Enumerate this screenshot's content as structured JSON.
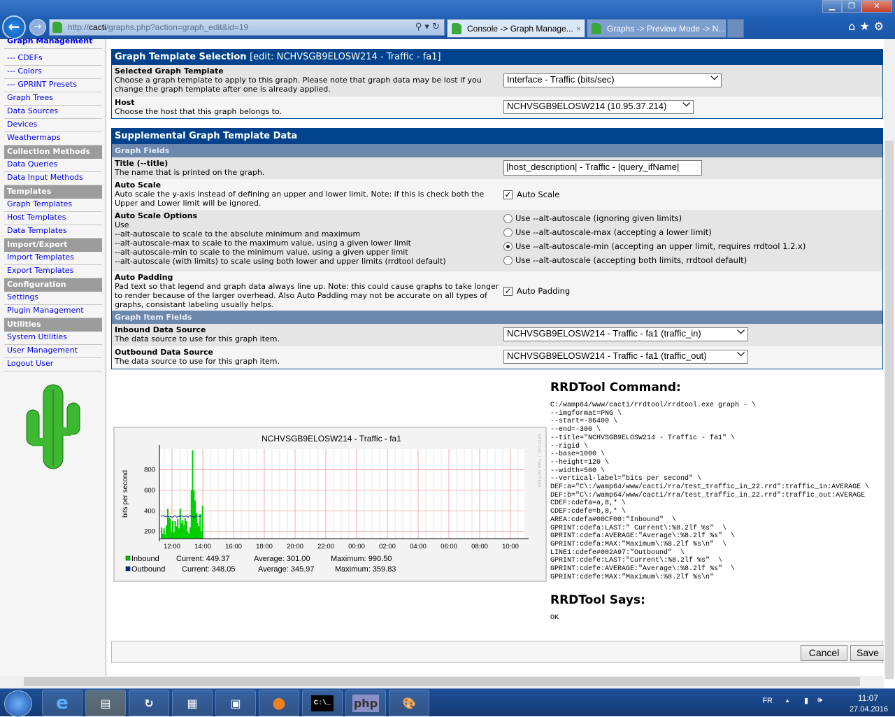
{
  "browser": {
    "url_prefix": "http://",
    "url_host": "cacti",
    "url_path": "/graphs.php?action=graph_edit&id=19",
    "tabs": [
      {
        "label": "Console -> Graph Manage...",
        "active": true
      },
      {
        "label": "Graphs -> Preview Mode -> N...",
        "active": false
      }
    ],
    "close_tab": "×"
  },
  "sidebar": {
    "items": [
      {
        "label": "Graph Management",
        "type": "link-bold"
      },
      {
        "label": "--- CDEFs",
        "type": "link"
      },
      {
        "label": "--- Colors",
        "type": "link"
      },
      {
        "label": "--- GPRINT Presets",
        "type": "link"
      },
      {
        "label": "Graph Trees",
        "type": "link"
      },
      {
        "label": "Data Sources",
        "type": "link"
      },
      {
        "label": "Devices",
        "type": "link"
      },
      {
        "label": "Weathermaps",
        "type": "link"
      },
      {
        "label": "Collection Methods",
        "type": "header"
      },
      {
        "label": "Data Queries",
        "type": "link"
      },
      {
        "label": "Data Input Methods",
        "type": "link"
      },
      {
        "label": "Templates",
        "type": "header"
      },
      {
        "label": "Graph Templates",
        "type": "link"
      },
      {
        "label": "Host Templates",
        "type": "link"
      },
      {
        "label": "Data Templates",
        "type": "link"
      },
      {
        "label": "Import/Export",
        "type": "header"
      },
      {
        "label": "Import Templates",
        "type": "link"
      },
      {
        "label": "Export Templates",
        "type": "link"
      },
      {
        "label": "Configuration",
        "type": "header"
      },
      {
        "label": "Settings",
        "type": "link"
      },
      {
        "label": "Plugin Management",
        "type": "link"
      },
      {
        "label": "Utilities",
        "type": "header"
      },
      {
        "label": "System Utilities",
        "type": "link"
      },
      {
        "label": "User Management",
        "type": "link"
      },
      {
        "label": "Logout User",
        "type": "link"
      }
    ]
  },
  "template_selection": {
    "title": "Graph Template Selection",
    "edit": "[edit: NCHVSGB9ELOSW214 - Traffic - fa1]",
    "selected_template": {
      "label": "Selected Graph Template",
      "desc": "Choose a graph template to apply to this graph. Please note that graph data may be lost if you change the graph template after one is already applied.",
      "value": "Interface - Traffic (bits/sec)"
    },
    "host": {
      "label": "Host",
      "desc": "Choose the host that this graph belongs to.",
      "value": "NCHVSGB9ELOSW214 (10.95.37.214)"
    }
  },
  "supplemental": {
    "title": "Supplemental Graph Template Data",
    "graph_fields": "Graph Fields",
    "title_field": {
      "label": "Title (--title)",
      "desc": "The name that is printed on the graph.",
      "value": "|host_description| - Traffic - |query_ifName|"
    },
    "auto_scale": {
      "label": "Auto Scale",
      "desc": "Auto scale the y-axis instead of defining an upper and lower limit. Note: if this is check both the Upper and Lower limit will be ignored.",
      "checkbox": "Auto Scale",
      "checked": true
    },
    "auto_scale_options": {
      "label": "Auto Scale Options",
      "desc": [
        "Use",
        "--alt-autoscale to scale to the absolute minimum and maximum",
        "--alt-autoscale-max to scale to the maximum value, using a given lower limit",
        "--alt-autoscale-min to scale to the minimum value, using a given upper limit",
        "--alt-autoscale (with limits) to scale using both lower and upper limits (rrdtool default)"
      ],
      "options": [
        "Use --alt-autoscale (ignoring given limits)",
        "Use --alt-autoscale-max (accepting a lower limit)",
        "Use --alt-autoscale-min (accepting an upper limit, requires rrdtool 1.2.x)",
        "Use --alt-autoscale (accepting both limits, rrdtool default)"
      ],
      "selected": 2
    },
    "auto_padding": {
      "label": "Auto Padding",
      "desc": "Pad text so that legend and graph data always line up. Note: this could cause graphs to take longer to render because of the larger overhead. Also Auto Padding may not be accurate on all types of graphs, consistant labeling usually helps.",
      "checkbox": "Auto Padding",
      "checked": true
    },
    "graph_item_fields": "Graph Item Fields",
    "inbound": {
      "label": "Inbound Data Source",
      "desc": "The data source to use for this graph item.",
      "value": "NCHVSGB9ELOSW214 - Traffic - fa1 (traffic_in)"
    },
    "outbound": {
      "label": "Outbound Data Source",
      "desc": "The data source to use for this graph item.",
      "value": "NCHVSGB9ELOSW214 - Traffic - fa1 (traffic_out)"
    }
  },
  "graph": {
    "title": "NCHVSGB9ELOSW214 - Traffic - fa1",
    "ylabel": "bits per second",
    "yticks": [
      "200",
      "400",
      "600",
      "800"
    ],
    "xticks": [
      "12:00",
      "14:00",
      "16:00",
      "18:00",
      "20:00",
      "22:00",
      "00:00",
      "02:00",
      "04:00",
      "06:00",
      "08:00",
      "10:00"
    ],
    "watermark": "RRDTOOL / TOBI OETIKER",
    "colors": {
      "inbound": "#00CF00",
      "outbound": "#002A97",
      "grid": "#F0A0A0"
    },
    "legend": [
      {
        "name": "Inbound",
        "current": "Current:  449.37",
        "average": "Average:  301.00",
        "maximum": "Maximum:  990.50"
      },
      {
        "name": "Outbound",
        "current": "Current:  348.05",
        "average": "Average:  345.97",
        "maximum": "Maximum:  359.83"
      }
    ],
    "inbound_values": [
      240,
      180,
      230,
      170,
      260,
      420,
      330,
      320,
      200,
      300,
      190,
      300,
      250,
      320,
      230,
      420,
      280,
      310,
      260,
      330,
      300,
      200,
      180,
      240,
      600,
      990,
      600,
      500,
      380,
      280,
      250,
      370,
      200,
      450
    ],
    "outbound_values": [
      345,
      350,
      352,
      346,
      344,
      350,
      348,
      340,
      345,
      338,
      342,
      352,
      348,
      336,
      350,
      345,
      346,
      355,
      340,
      344,
      350,
      345,
      338,
      352,
      350,
      345,
      348,
      330,
      350,
      352,
      345,
      348,
      350,
      348
    ]
  },
  "rrd_command": {
    "title": "RRDTool Command:",
    "lines": [
      "C:/wamp64/www/cacti/rrdtool/rrdtool.exe graph - \\",
      "--imgformat=PNG \\",
      "--start=-86400 \\",
      "--end=-300 \\",
      "--title=\"NCHVSGB9ELOSW214 - Traffic - fa1\" \\",
      "--rigid \\",
      "--base=1000 \\",
      "--height=120 \\",
      "--width=500 \\",
      "--vertical-label=\"bits per second\" \\",
      "DEF:a=\"C\\:/wamp64/www/cacti/rra/test_traffic_in_22.rrd\":traffic_in:AVERAGE \\",
      "DEF:b=\"C\\:/wamp64/www/cacti/rra/test_traffic_in_22.rrd\":traffic_out:AVERAGE",
      "CDEF:cdefa=a,8,* \\",
      "CDEF:cdefe=b,8,* \\",
      "AREA:cdefa#00CF00:\"Inbound\"  \\",
      "GPRINT:cdefa:LAST:\" Current\\:%8.2lf %s\"  \\",
      "GPRINT:cdefa:AVERAGE:\"Average\\:%8.2lf %s\"  \\",
      "GPRINT:cdefa:MAX:\"Maximum\\:%8.2lf %s\\n\"  \\",
      "LINE1:cdefe#002A97:\"Outbound\"  \\",
      "GPRINT:cdefe:LAST:\"Current\\:%8.2lf %s\"  \\",
      "GPRINT:cdefe:AVERAGE:\"Average\\:%8.2lf %s\"  \\",
      "GPRINT:cdefe:MAX:\"Maximum\\:%8.2lf %s\\n\""
    ],
    "says_title": "RRDTool Says:",
    "says": "OK"
  },
  "buttons": {
    "cancel": "Cancel",
    "save": "Save"
  },
  "taskbar": {
    "lang": "FR",
    "time": "11:07",
    "date": "27.04.2016",
    "cmd_label": "C:\\_",
    "php_label": "php"
  }
}
